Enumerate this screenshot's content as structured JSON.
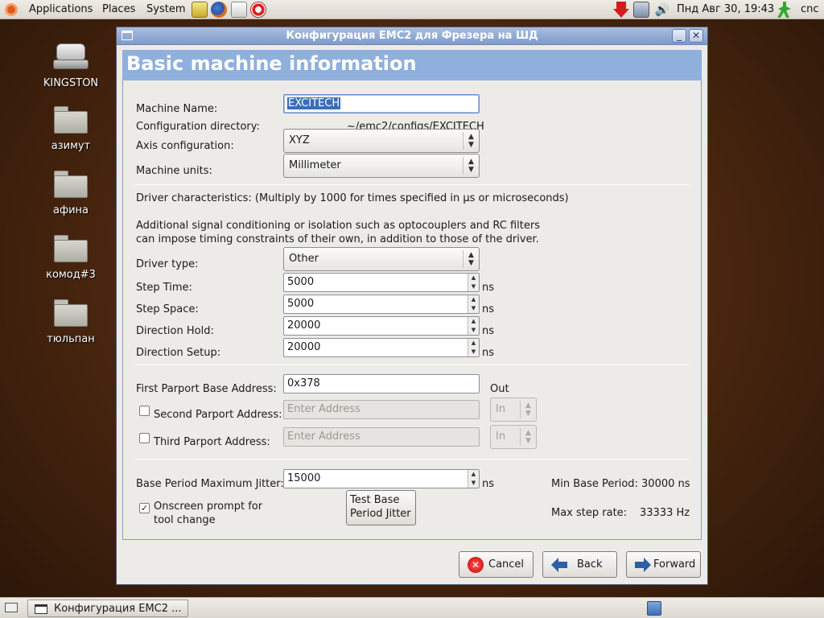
{
  "top_panel": {
    "menus": [
      "Applications",
      "Places",
      "System"
    ],
    "clock": "Пнд Авг 30, 19:43",
    "user": "cnc"
  },
  "desktop": {
    "icons": [
      {
        "label": "KINGSTON",
        "type": "drive-icon"
      },
      {
        "label": "азимут",
        "type": "folder-icon"
      },
      {
        "label": "афина",
        "type": "folder-icon"
      },
      {
        "label": "комод#3",
        "type": "folder-icon"
      },
      {
        "label": "тюльпан",
        "type": "folder-icon"
      }
    ]
  },
  "window": {
    "title": "Конфигурация EMC2 для Фрезера на ШД",
    "header": "Basic machine information",
    "machine_name_label": "Machine Name:",
    "machine_name_value": "EXCITECH",
    "config_dir_label": "Configuration directory:",
    "config_dir_value": "~/emc2/configs/EXCITECH",
    "axis_label": "Axis configuration:",
    "axis_value": "XYZ",
    "units_label": "Machine units:",
    "units_value": "Millimeter",
    "driver_char_text": "Driver characteristics: (Multiply by 1000 for times specified in µs or microseconds)",
    "signal_text_1": "Additional signal conditioning or isolation such as optocouplers and RC filters",
    "signal_text_2": "can impose timing constraints of their own, in addition to those of the driver.",
    "driver_type_label": "Driver type:",
    "driver_type_value": "Other",
    "step_time_label": "Step Time:",
    "step_time_value": "5000",
    "step_space_label": "Step Space:",
    "step_space_value": "5000",
    "dir_hold_label": "Direction Hold:",
    "dir_hold_value": "20000",
    "dir_setup_label": "Direction Setup:",
    "dir_setup_value": "20000",
    "unit_ns": "ns",
    "parport1_label": "First Parport Base Address:",
    "parport1_value": "0x378",
    "parport1_dir": "Out",
    "parport2_label": "Second Parport Address:",
    "parport3_label": "Third Parport Address:",
    "address_placeholder": "Enter Address",
    "in_option": "In",
    "jitter_label": "Base Period Maximum Jitter:",
    "jitter_value": "15000",
    "min_base_period": "Min Base Period: 30000 ns",
    "onscreen_prompt_1": "Onscreen prompt for",
    "onscreen_prompt_2": "tool change",
    "test_jitter_1": "Test Base",
    "test_jitter_2": "Period Jitter",
    "max_step_label": "Max step rate:",
    "max_step_value": "33333 Hz",
    "cancel": "Cancel",
    "back": "Back",
    "forward": "Forward"
  },
  "taskbar": {
    "task_label": "Конфигурация EMC2 ..."
  },
  "colors": {
    "header_band": "#8fb0dc",
    "titlebar": "#7e9bcc",
    "selection": "#3a6fb8"
  }
}
